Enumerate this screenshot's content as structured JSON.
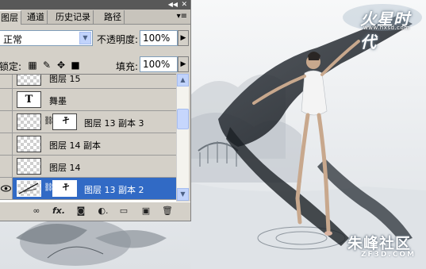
{
  "panel": {
    "tabs": [
      {
        "label": "图层",
        "active": true
      },
      {
        "label": "通道",
        "active": false
      },
      {
        "label": "历史记录",
        "active": false
      },
      {
        "label": "路径",
        "active": false
      }
    ],
    "blend_mode": "正常",
    "opacity_label": "不透明度:",
    "opacity_value": "100%",
    "lock_label": "锁定:",
    "fill_label": "填充:",
    "fill_value": "100%",
    "layers": [
      {
        "name": "图层 15",
        "type": "raster",
        "selected": false,
        "visible": false
      },
      {
        "name": "舞墨",
        "type": "text",
        "selected": false,
        "visible": false
      },
      {
        "name": "图层 13 副本 3",
        "type": "masked",
        "selected": false,
        "visible": false
      },
      {
        "name": "图层 14 副本",
        "type": "raster",
        "selected": false,
        "visible": false
      },
      {
        "name": "图层 14",
        "type": "raster",
        "selected": false,
        "visible": false
      },
      {
        "name": "图层 13 副本 2",
        "type": "masked",
        "selected": true,
        "visible": true
      }
    ],
    "bottom_icons": [
      "link-icon",
      "fx-icon",
      "mask-icon",
      "adjustment-icon",
      "group-folder-icon",
      "new-layer-icon",
      "trash-icon"
    ],
    "selection_color": "#316ac5"
  },
  "watermarks": {
    "logo_text": "火星时代",
    "logo_url": "www.hxsd.com",
    "bottom_text": "朱峰社区",
    "bottom_url": "ZF3D.COM"
  }
}
